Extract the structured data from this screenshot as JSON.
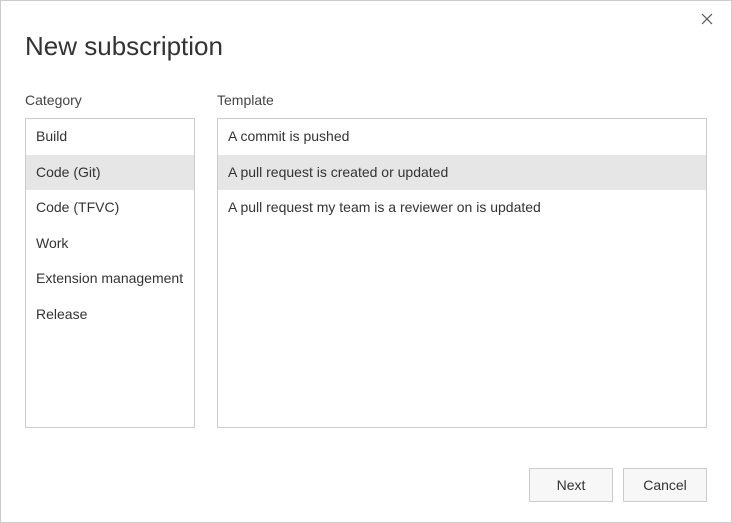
{
  "title": "New subscription",
  "labels": {
    "category": "Category",
    "template": "Template"
  },
  "categories": [
    {
      "label": "Build",
      "selected": false
    },
    {
      "label": "Code (Git)",
      "selected": true
    },
    {
      "label": "Code (TFVC)",
      "selected": false
    },
    {
      "label": "Work",
      "selected": false
    },
    {
      "label": "Extension management",
      "selected": false
    },
    {
      "label": "Release",
      "selected": false
    }
  ],
  "templates": [
    {
      "label": "A commit is pushed",
      "selected": false
    },
    {
      "label": "A pull request is created or updated",
      "selected": true
    },
    {
      "label": "A pull request my team is a reviewer on is updated",
      "selected": false
    }
  ],
  "buttons": {
    "next": "Next",
    "cancel": "Cancel"
  }
}
